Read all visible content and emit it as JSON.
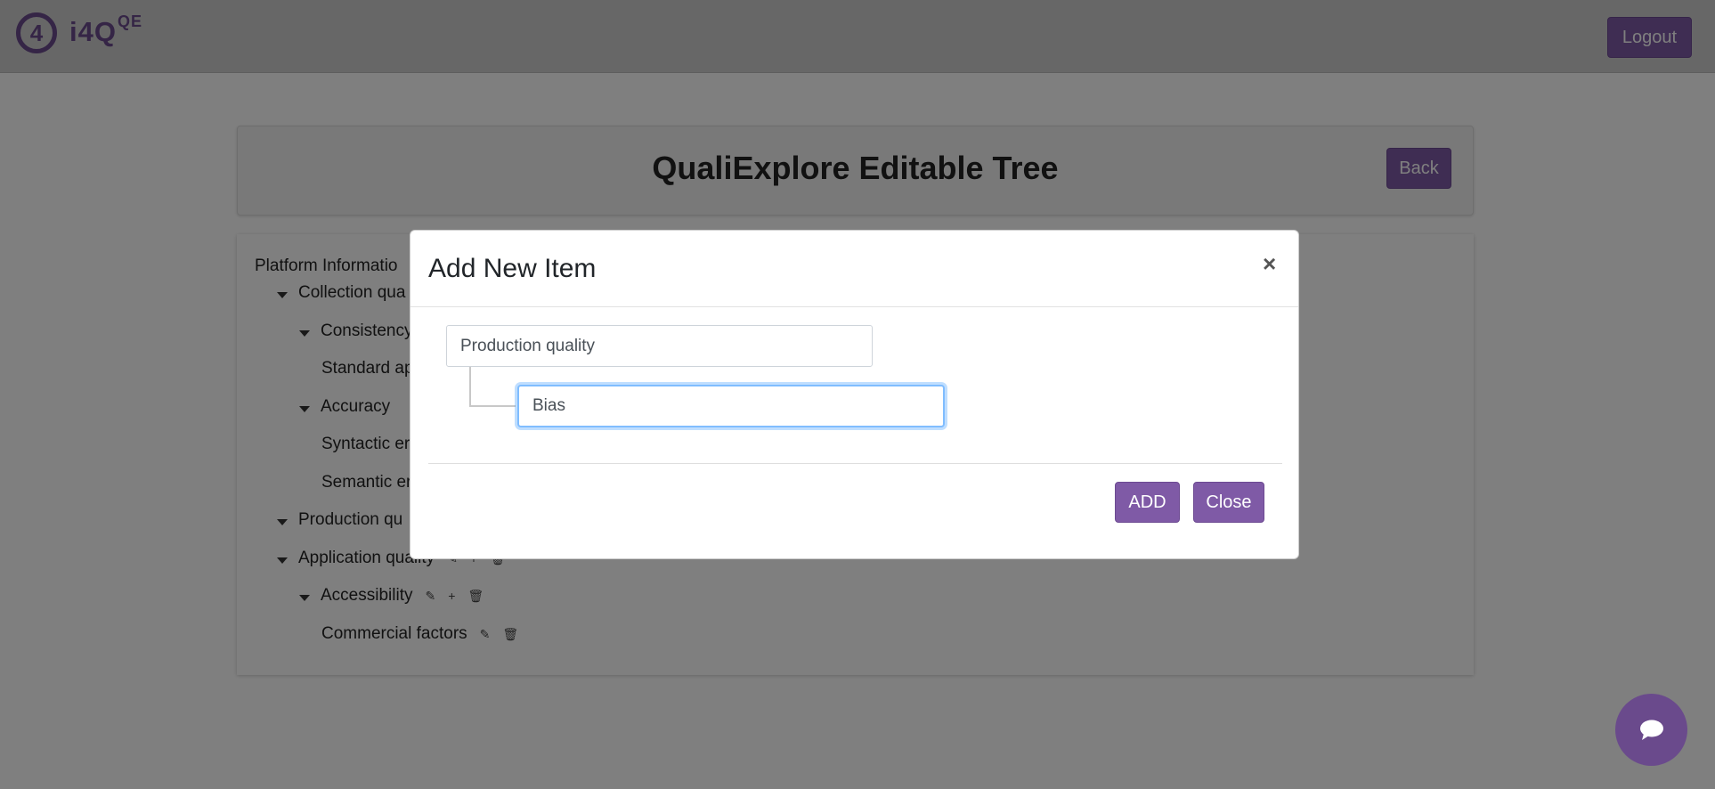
{
  "app": {
    "logo_letter": "4",
    "logo_text": "i4Q",
    "logo_sup": "QE",
    "logout_label": "Logout"
  },
  "header": {
    "title": "QualiExplore Editable Tree",
    "back_label": "Back"
  },
  "tree": {
    "items": [
      {
        "label": "Platform Informatio"
      },
      {
        "label": "Collection qua"
      },
      {
        "label": "Consistency"
      },
      {
        "label": "Standard ap"
      },
      {
        "label": "Accuracy"
      },
      {
        "label": "Syntactic er"
      },
      {
        "label": "Semantic er"
      },
      {
        "label": "Production qu"
      },
      {
        "label": "Application quality"
      },
      {
        "label": "Accessibility"
      },
      {
        "label": "Commercial factors"
      }
    ]
  },
  "modal": {
    "title": "Add New Item",
    "close_symbol": "×",
    "parent_value": "Production quality",
    "child_value": "Bias",
    "add_label": "ADD",
    "close_label": "Close"
  },
  "colors": {
    "accent": "#7f5aa6",
    "brand": "#6a4a8c"
  },
  "icons": {
    "edit": "edit-icon",
    "add": "plus-icon",
    "delete": "trash-icon",
    "chat": "chat-icon"
  }
}
